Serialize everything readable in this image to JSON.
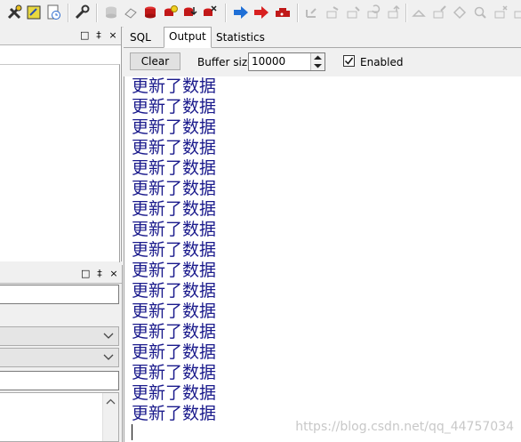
{
  "toolbar": {
    "icons": [
      "tools-icon",
      "edit-icon",
      "document-clock-icon",
      "wrench-icon",
      "database-disabled-icon",
      "eraser-icon",
      "database-red-icon",
      "database-yellow-icon",
      "database-down-icon",
      "database-delete-icon",
      "arrow-right-blue-icon",
      "arrow-right-red-icon",
      "stop-icon",
      "nav-icons"
    ]
  },
  "tabs": {
    "sql": "SQL",
    "output": "Output",
    "statistics": "Statistics"
  },
  "output_bar": {
    "clear_label": "Clear",
    "buffer_label": "Buffer size",
    "buffer_value": "10000",
    "enabled_label": "Enabled",
    "enabled_checked": true
  },
  "output": {
    "lines": [
      "更新了数据",
      "更新了数据",
      "更新了数据",
      "更新了数据",
      "更新了数据",
      "更新了数据",
      "更新了数据",
      "更新了数据",
      "更新了数据",
      "更新了数据",
      "更新了数据",
      "更新了数据",
      "更新了数据",
      "更新了数据",
      "更新了数据",
      "更新了数据",
      "更新了数据"
    ],
    "watermark": "https://blog.csdn.net/qq_44757034"
  },
  "panel_buttons": {
    "restore": "□",
    "pin": "‡",
    "close": "×"
  },
  "colors": {
    "output_text": "#1a1a8c",
    "accent_blue": "#1f6fd6",
    "accent_red": "#d82020"
  }
}
